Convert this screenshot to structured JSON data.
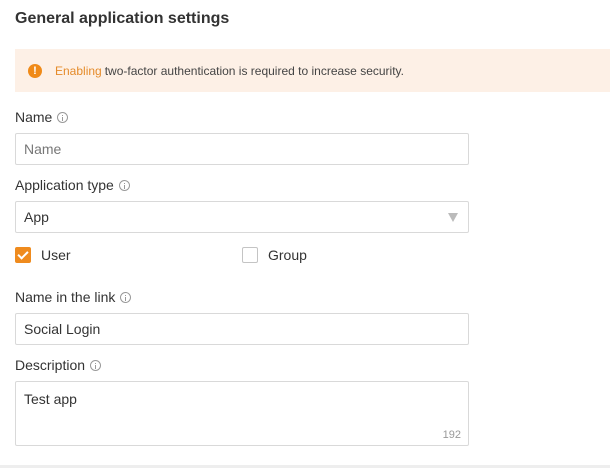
{
  "page": {
    "title": "General application settings"
  },
  "alert": {
    "icon": "exclamation-circle-icon",
    "link_text": "Enabling",
    "message": "two-factor authentication is required to increase security.",
    "accent_color": "#f08a18",
    "background_color": "#fdf0e6"
  },
  "fields": {
    "name": {
      "label": "Name",
      "placeholder": "Name",
      "value": ""
    },
    "application_type": {
      "label": "Application type",
      "value": "App"
    },
    "user_checkbox": {
      "label": "User",
      "checked": true
    },
    "group_checkbox": {
      "label": "Group",
      "checked": false
    },
    "name_in_link": {
      "label": "Name in the link",
      "value": "Social Login"
    },
    "description": {
      "label": "Description",
      "value": "Test app",
      "remaining_chars": "192"
    }
  }
}
